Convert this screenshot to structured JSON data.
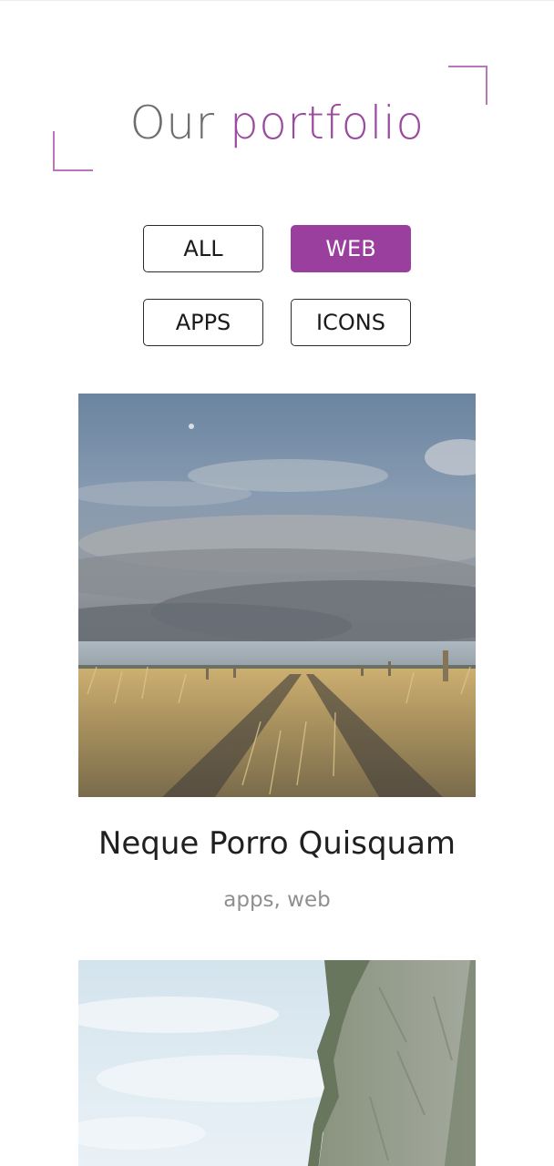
{
  "header": {
    "title_word1": "Our",
    "title_word2": "portfolio"
  },
  "filters": {
    "all": "ALL",
    "web": "WEB",
    "apps": "APPS",
    "icons": "ICONS",
    "active": "web"
  },
  "portfolio": {
    "items": [
      {
        "title": "Neque Porro Quisquam",
        "tags": "apps, web",
        "image": "field-path-cloudy-sky-photo"
      },
      {
        "image": "sky-cliff-photo"
      }
    ]
  },
  "colors": {
    "accent": "#9a3f9d",
    "corner": "#b877b9"
  }
}
